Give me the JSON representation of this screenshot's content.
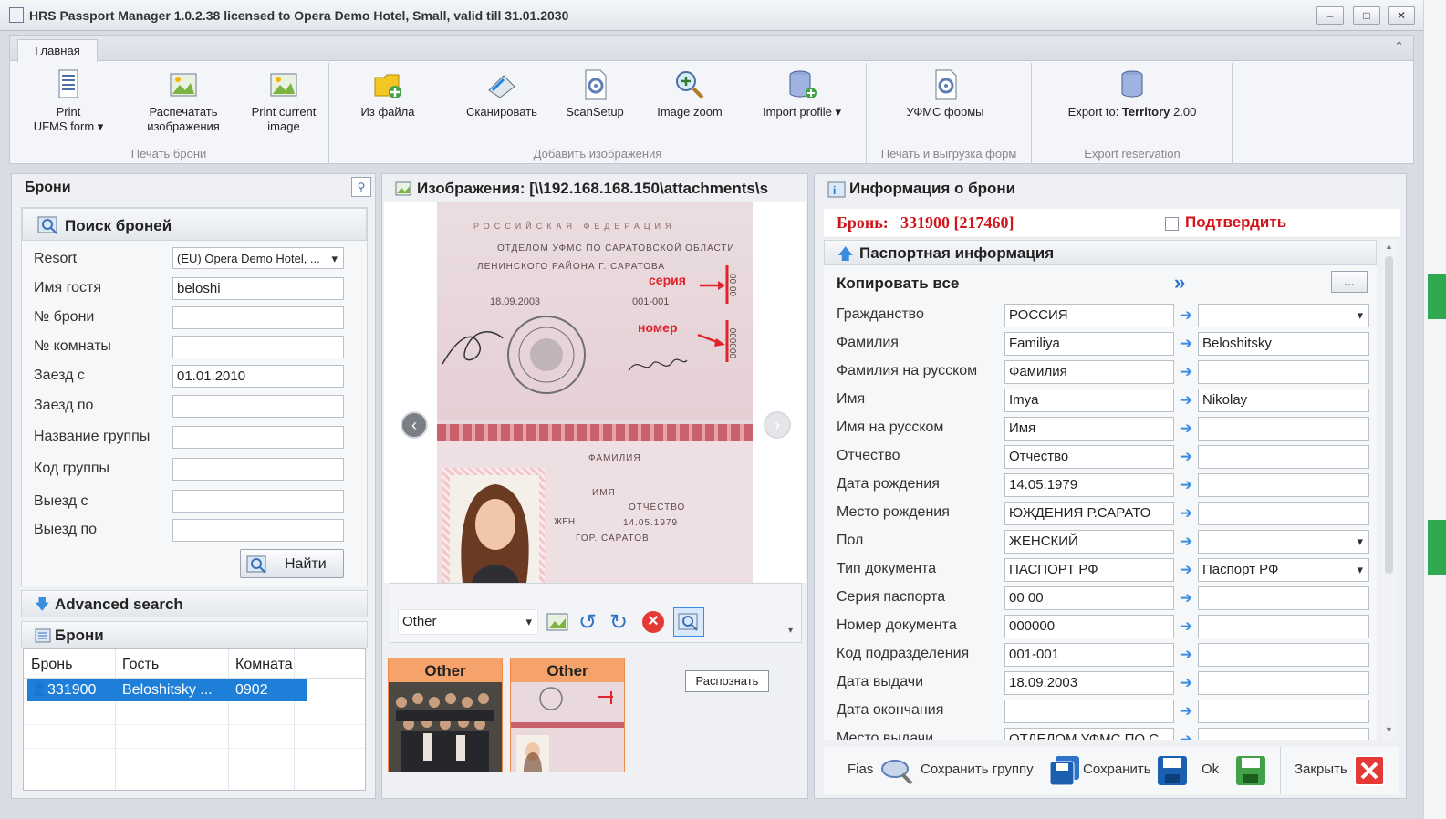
{
  "window": {
    "title": "HRS Passport Manager 1.0.2.38 licensed to Opera Demo Hotel, Small, valid till 31.01.2030"
  },
  "ribbon": {
    "tab": "Главная",
    "buttons": [
      {
        "label1": "Print",
        "label2": "UFMS form ▾"
      },
      {
        "label1": "Распечатать",
        "label2": "изображения"
      },
      {
        "label1": "Print current",
        "label2": "image"
      },
      {
        "label1": "Из файла",
        "label2": ""
      },
      {
        "label1": "Сканировать",
        "label2": ""
      },
      {
        "label1": "ScanSetup",
        "label2": ""
      },
      {
        "label1": "Image zoom",
        "label2": ""
      },
      {
        "label1": "Import profile ▾",
        "label2": ""
      },
      {
        "label1": "УФМС формы",
        "label2": ""
      },
      {
        "label1": "Export to: ",
        "label_bold": "Territory",
        "label_tail": " 2.00"
      }
    ],
    "groups": [
      "Печать брони",
      "Добавить изображения",
      "Печать и выгрузка форм",
      "Export reservation"
    ]
  },
  "left": {
    "header": "Брони",
    "search": {
      "title": "Поиск броней",
      "fields": [
        {
          "label": "Resort",
          "value": "(EU) Opera Demo Hotel, ..."
        },
        {
          "label": "Имя гостя",
          "value": "beloshi"
        },
        {
          "label": "№ брони",
          "value": ""
        },
        {
          "label": "№ комнаты",
          "value": ""
        },
        {
          "label": "Заезд с",
          "value": "01.01.2010"
        },
        {
          "label": "Заезд по",
          "value": ""
        },
        {
          "label": "Название группы",
          "value": ""
        },
        {
          "label": "Код группы",
          "value": ""
        },
        {
          "label": "Выезд с",
          "value": ""
        },
        {
          "label": "Выезд по",
          "value": ""
        }
      ],
      "find_label": "Найти"
    },
    "advanced": "Advanced search",
    "list": {
      "title": "Брони",
      "columns": [
        "Бронь",
        "Гость",
        "Комната"
      ],
      "rows": [
        {
          "id": "331900",
          "guest": "Beloshitsky ...",
          "room": "0902"
        }
      ]
    }
  },
  "middle": {
    "header": "Изображения: [\\\\192.168.168.150\\attachments\\s",
    "passport": {
      "top_text1": "РОССИЙСКАЯ ФЕДЕРАЦИЯ",
      "top_text2": "ОТДЕЛОМ УФМС ПО САРАТОВСКОЙ ОБЛАСТИ",
      "top_text3": "ЛЕНИНСКОГО РАЙОНА Г. САРАТОВА",
      "date": "18.09.2003",
      "code": "001-001",
      "seria": "серия",
      "nomer": "номер",
      "surname_lbl": "ФАМИЛИЯ",
      "name_lbl": "ИМЯ",
      "patr_lbl": "ОТЧЕСТВО",
      "sex": "ЖЕН",
      "dob": "14.05.1979",
      "pob": "ГОР. САРАТОВ"
    },
    "toolbar": {
      "type_value": "Other"
    },
    "thumbs": [
      "Other",
      "Other"
    ],
    "recognize_label": "Распознать"
  },
  "right": {
    "header": "Информация о брони",
    "booking_label": "Бронь:",
    "booking_value": "331900 [217460]",
    "confirm_label": "Подтвердить",
    "section": "Паспортная информация",
    "copy_all": "Копировать все",
    "more": "...",
    "rows": [
      {
        "label": "Гражданство",
        "value": "РОССИЯ",
        "target": "",
        "dropdown": true
      },
      {
        "label": "Фамилия",
        "value": "Familiya",
        "target": "Beloshitsky",
        "dropdown": false
      },
      {
        "label": "Фамилия на русском",
        "value": "Фамилия",
        "target": "",
        "dropdown": false
      },
      {
        "label": "Имя",
        "value": "Imya",
        "target": "Nikolay",
        "dropdown": false
      },
      {
        "label": "Имя на русском",
        "value": "Имя",
        "target": "",
        "dropdown": false
      },
      {
        "label": "Отчество",
        "value": "Отчество",
        "target": "",
        "dropdown": false
      },
      {
        "label": "Дата рождения",
        "value": "14.05.1979",
        "target": "",
        "dropdown": false
      },
      {
        "label": "Место рождения",
        "value": "ЮЖДЕНИЯ Р.САРАТО",
        "target": "",
        "dropdown": false
      },
      {
        "label": "Пол",
        "value": "ЖЕНСКИЙ",
        "target": "",
        "dropdown": true
      },
      {
        "label": "Тип документа",
        "value": "ПАСПОРТ РФ",
        "target": "Паспорт РФ",
        "dropdown": true
      },
      {
        "label": "Серия паспорта",
        "value": "00 00",
        "target": "",
        "dropdown": false
      },
      {
        "label": "Номер документа",
        "value": "000000",
        "target": "",
        "dropdown": false
      },
      {
        "label": "Код подразделения",
        "value": "001-001",
        "target": "",
        "dropdown": false
      },
      {
        "label": "Дата выдачи",
        "value": "18.09.2003",
        "target": "",
        "dropdown": false
      },
      {
        "label": "Дата окончания",
        "value": "",
        "target": "",
        "dropdown": false
      },
      {
        "label": "Место выдачи",
        "value": "ОТДЕЛОМ УФМС ПО С",
        "target": "",
        "dropdown": false
      }
    ],
    "buttons": {
      "fias": "Fias",
      "save_group": "Сохранить группу",
      "save": "Сохранить",
      "ok": "Ok",
      "close": "Закрыть"
    }
  },
  "colors": {
    "accent": "#1e7fd8",
    "booking_red": "#d0161b",
    "selection": "#1e7fd8"
  }
}
